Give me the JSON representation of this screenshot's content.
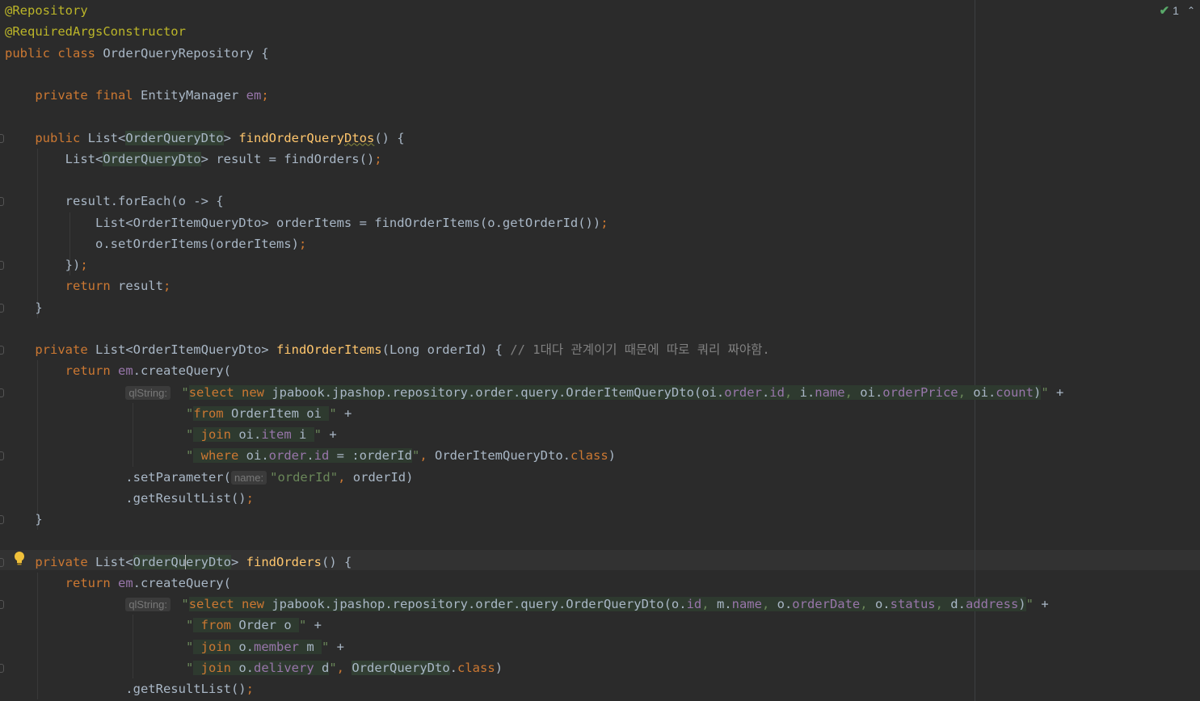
{
  "status": {
    "inspection_count": "1",
    "check_icon": "✔",
    "up_icon": "⌃"
  },
  "lines": [
    [
      [
        "ann",
        "@Repository"
      ]
    ],
    [
      [
        "ann",
        "@RequiredArgsConstructor"
      ]
    ],
    [
      [
        "kw",
        "public class "
      ],
      [
        "plain",
        "OrderQueryRepository {"
      ]
    ],
    [],
    [
      [
        "kw",
        "    private final "
      ],
      [
        "plain",
        "EntityManager "
      ],
      [
        "fld",
        "em"
      ],
      [
        "kw",
        ";"
      ]
    ],
    [],
    [
      [
        "kw",
        "    public "
      ],
      [
        "plain",
        "List<"
      ],
      [
        "gen",
        "OrderQueryDto"
      ],
      [
        "plain",
        "> "
      ],
      [
        "fn",
        "findOrderQuery"
      ],
      [
        "fnsq",
        "Dtos"
      ],
      [
        "plain",
        "() {"
      ]
    ],
    [
      [
        "plain",
        "        List<"
      ],
      [
        "gen",
        "OrderQueryDto"
      ],
      [
        "plain",
        "> result = findOrders()"
      ],
      [
        "kw",
        ";"
      ]
    ],
    [],
    [
      [
        "plain",
        "        result.forEach(o -> {"
      ]
    ],
    [
      [
        "plain",
        "            List<OrderItemQueryDto> orderItems = findOrderItems(o.getOrderId())"
      ],
      [
        "kw",
        ";"
      ]
    ],
    [
      [
        "plain",
        "            o.setOrderItems(orderItems)"
      ],
      [
        "kw",
        ";"
      ]
    ],
    [
      [
        "plain",
        "        })"
      ],
      [
        "kw",
        ";"
      ]
    ],
    [
      [
        "kw",
        "        return "
      ],
      [
        "plain",
        "result"
      ],
      [
        "kw",
        ";"
      ]
    ],
    [
      [
        "plain",
        "    }"
      ]
    ],
    [],
    [
      [
        "kw",
        "    private "
      ],
      [
        "plain",
        "List<OrderItemQueryDto> "
      ],
      [
        "fn",
        "findOrderItems"
      ],
      [
        "plain",
        "(Long orderId) { "
      ],
      [
        "cmt",
        "// 1대다 관계이기 때문에 따로 쿼리 짜야함."
      ]
    ],
    [
      [
        "kw",
        "        return "
      ],
      [
        "fld",
        "em"
      ],
      [
        "plain",
        ".createQuery("
      ]
    ],
    [
      [
        "plain",
        "                "
      ],
      [
        "hint",
        "qlString:"
      ],
      [
        "str",
        " \""
      ],
      [
        "kwi",
        "select new "
      ],
      [
        "inj",
        "jpabook.jpashop.repository.order.query.OrderItemQueryDto(oi."
      ],
      [
        "fldi",
        "order"
      ],
      [
        "inj",
        "."
      ],
      [
        "fldi",
        "id"
      ],
      [
        "stri",
        ", "
      ],
      [
        "inj",
        "i."
      ],
      [
        "fldi",
        "name"
      ],
      [
        "stri",
        ", "
      ],
      [
        "inj",
        "oi."
      ],
      [
        "fldi",
        "orderPrice"
      ],
      [
        "stri",
        ", "
      ],
      [
        "inj",
        "oi."
      ],
      [
        "fldi",
        "count"
      ],
      [
        "inj",
        ")"
      ],
      [
        "str",
        "\""
      ],
      [
        "plain",
        " +"
      ]
    ],
    [
      [
        "plain",
        "                        "
      ],
      [
        "str",
        "\""
      ],
      [
        "kwi",
        "from "
      ],
      [
        "inj",
        "OrderItem oi "
      ],
      [
        "str",
        "\""
      ],
      [
        "plain",
        " +"
      ]
    ],
    [
      [
        "plain",
        "                        "
      ],
      [
        "str",
        "\""
      ],
      [
        "stri",
        " "
      ],
      [
        "kwi",
        "join "
      ],
      [
        "inj",
        "oi."
      ],
      [
        "fldi",
        "item"
      ],
      [
        "inj",
        " i "
      ],
      [
        "str",
        "\""
      ],
      [
        "plain",
        " +"
      ]
    ],
    [
      [
        "plain",
        "                        "
      ],
      [
        "str",
        "\""
      ],
      [
        "stri",
        " "
      ],
      [
        "kwi",
        "where "
      ],
      [
        "inj",
        "oi."
      ],
      [
        "fldi",
        "order"
      ],
      [
        "inj",
        "."
      ],
      [
        "fldi",
        "id"
      ],
      [
        "inj",
        " = :orderId"
      ],
      [
        "str",
        "\""
      ],
      [
        "kw",
        ", "
      ],
      [
        "plain",
        "OrderItemQueryDto."
      ],
      [
        "kw",
        "class"
      ],
      [
        "plain",
        ")"
      ]
    ],
    [
      [
        "plain",
        "                .setParameter("
      ],
      [
        "hint",
        "name:"
      ],
      [
        "str",
        "\"orderId\""
      ],
      [
        "kw",
        ", "
      ],
      [
        "plain",
        "orderId)"
      ]
    ],
    [
      [
        "plain",
        "                .getResultList()"
      ],
      [
        "kw",
        ";"
      ]
    ],
    [
      [
        "plain",
        "    }"
      ]
    ],
    [],
    [
      [
        "kw",
        "    private "
      ],
      [
        "plain",
        "List<"
      ],
      [
        "gen",
        "OrderQu"
      ],
      [
        "caret",
        ""
      ],
      [
        "gen",
        "eryDto"
      ],
      [
        "plain",
        "> "
      ],
      [
        "fn",
        "findOrders"
      ],
      [
        "plain",
        "() {"
      ]
    ],
    [
      [
        "kw",
        "        return "
      ],
      [
        "fld",
        "em"
      ],
      [
        "plain",
        ".createQuery("
      ]
    ],
    [
      [
        "plain",
        "                "
      ],
      [
        "hint",
        "qlString:"
      ],
      [
        "str",
        " \""
      ],
      [
        "kwi",
        "select new "
      ],
      [
        "inj",
        "jpabook.jpashop.repository.order.query.OrderQueryDto(o."
      ],
      [
        "fldi",
        "id"
      ],
      [
        "stri",
        ", "
      ],
      [
        "inj",
        "m."
      ],
      [
        "fldi",
        "name"
      ],
      [
        "stri",
        ", "
      ],
      [
        "inj",
        "o."
      ],
      [
        "fldi",
        "orderDate"
      ],
      [
        "stri",
        ", "
      ],
      [
        "inj",
        "o."
      ],
      [
        "fldi",
        "status"
      ],
      [
        "stri",
        ", "
      ],
      [
        "inj",
        "d."
      ],
      [
        "fldi",
        "address"
      ],
      [
        "inj",
        ")"
      ],
      [
        "str",
        "\""
      ],
      [
        "plain",
        " +"
      ]
    ],
    [
      [
        "plain",
        "                        "
      ],
      [
        "str",
        "\""
      ],
      [
        "stri",
        " "
      ],
      [
        "kwi",
        "from "
      ],
      [
        "inj",
        "Order o "
      ],
      [
        "str",
        "\""
      ],
      [
        "plain",
        " +"
      ]
    ],
    [
      [
        "plain",
        "                        "
      ],
      [
        "str",
        "\""
      ],
      [
        "stri",
        " "
      ],
      [
        "kwi",
        "join "
      ],
      [
        "inj",
        "o."
      ],
      [
        "fldi",
        "member"
      ],
      [
        "inj",
        " m "
      ],
      [
        "str",
        "\""
      ],
      [
        "plain",
        " +"
      ]
    ],
    [
      [
        "plain",
        "                        "
      ],
      [
        "str",
        "\""
      ],
      [
        "stri",
        " "
      ],
      [
        "kwi",
        "join "
      ],
      [
        "inj",
        "o."
      ],
      [
        "fldi",
        "delivery"
      ],
      [
        "inj",
        " d"
      ],
      [
        "str",
        "\""
      ],
      [
        "kw",
        ", "
      ],
      [
        "gen",
        "OrderQueryDto"
      ],
      [
        "plain",
        "."
      ],
      [
        "kw",
        "class"
      ],
      [
        "plain",
        ")"
      ]
    ],
    [
      [
        "plain",
        "                .getResultList()"
      ],
      [
        "kw",
        ";"
      ]
    ]
  ]
}
